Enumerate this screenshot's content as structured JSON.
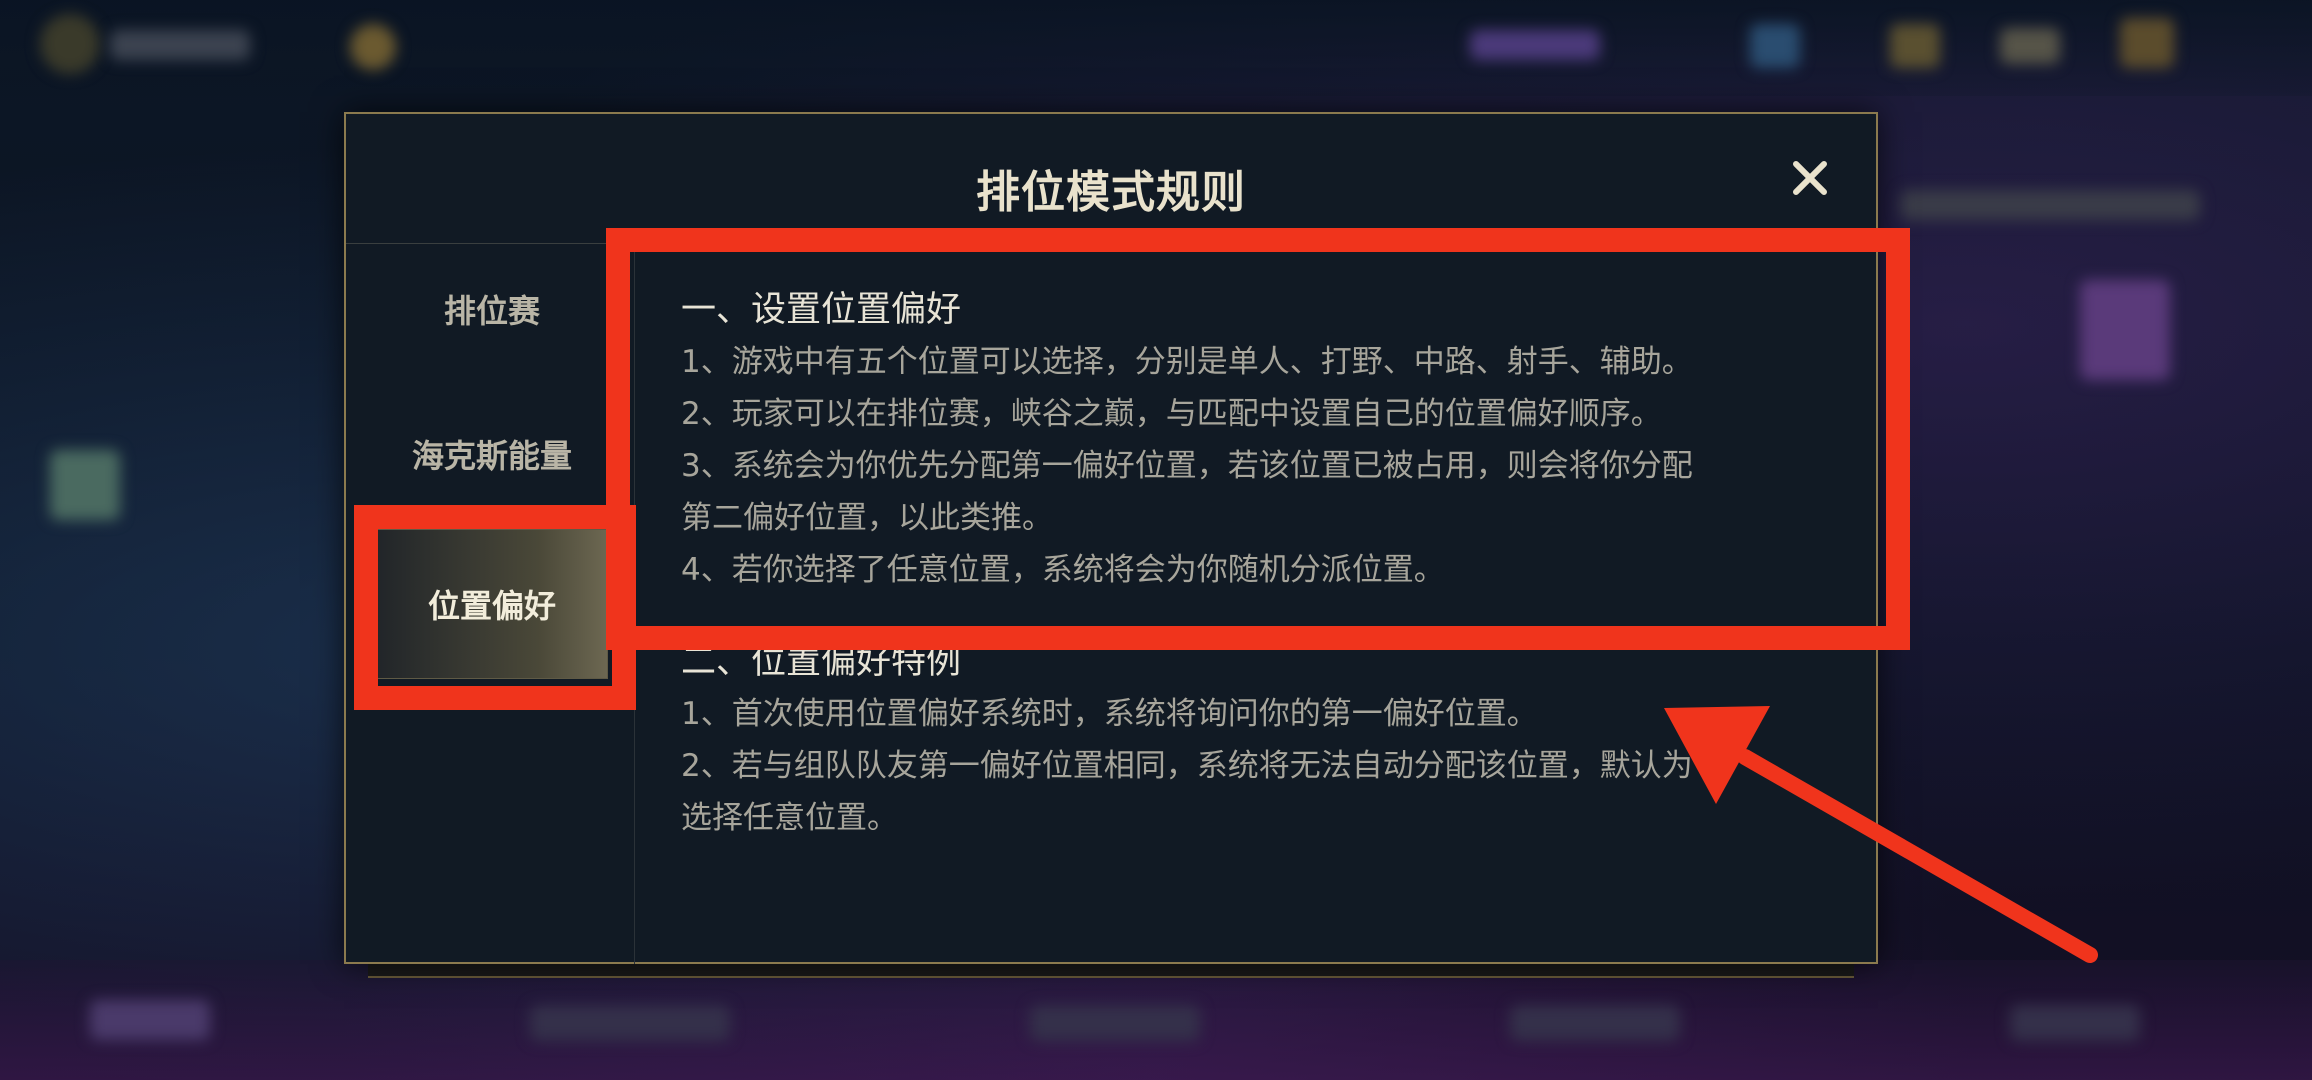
{
  "dialog": {
    "title": "排位模式规则",
    "close_icon": "close-icon",
    "tabs": [
      {
        "label": "排位赛",
        "active": false
      },
      {
        "label": "海克斯能量",
        "active": false
      },
      {
        "label": "位置偏好",
        "active": true
      }
    ],
    "sections": [
      {
        "heading": "一、设置位置偏好",
        "lines": [
          "1、游戏中有五个位置可以选择，分别是单人、打野、中路、射手、辅助。",
          "2、玩家可以在排位赛，峡谷之巅，与匹配中设置自己的位置偏好顺序。",
          "3、系统会为你优先分配第一偏好位置，若该位置已被占用，则会将你分配",
          "第二偏好位置，以此类推。",
          "4、若你选择了任意位置，系统将会为你随机分派位置。"
        ]
      },
      {
        "heading": "二、位置偏好特例",
        "lines": [
          "1、首次使用位置偏好系统时，系统将询问你的第一偏好位置。",
          "2、若与组队队友第一偏好位置相同，系统将无法自动分配该位置，默认为",
          "选择任意位置。"
        ]
      }
    ]
  },
  "colors": {
    "gold_border": "#8b7a4e",
    "title_text": "#e9e2cc",
    "body_text": "#a7a59b",
    "annotation_red": "#f0341c"
  }
}
